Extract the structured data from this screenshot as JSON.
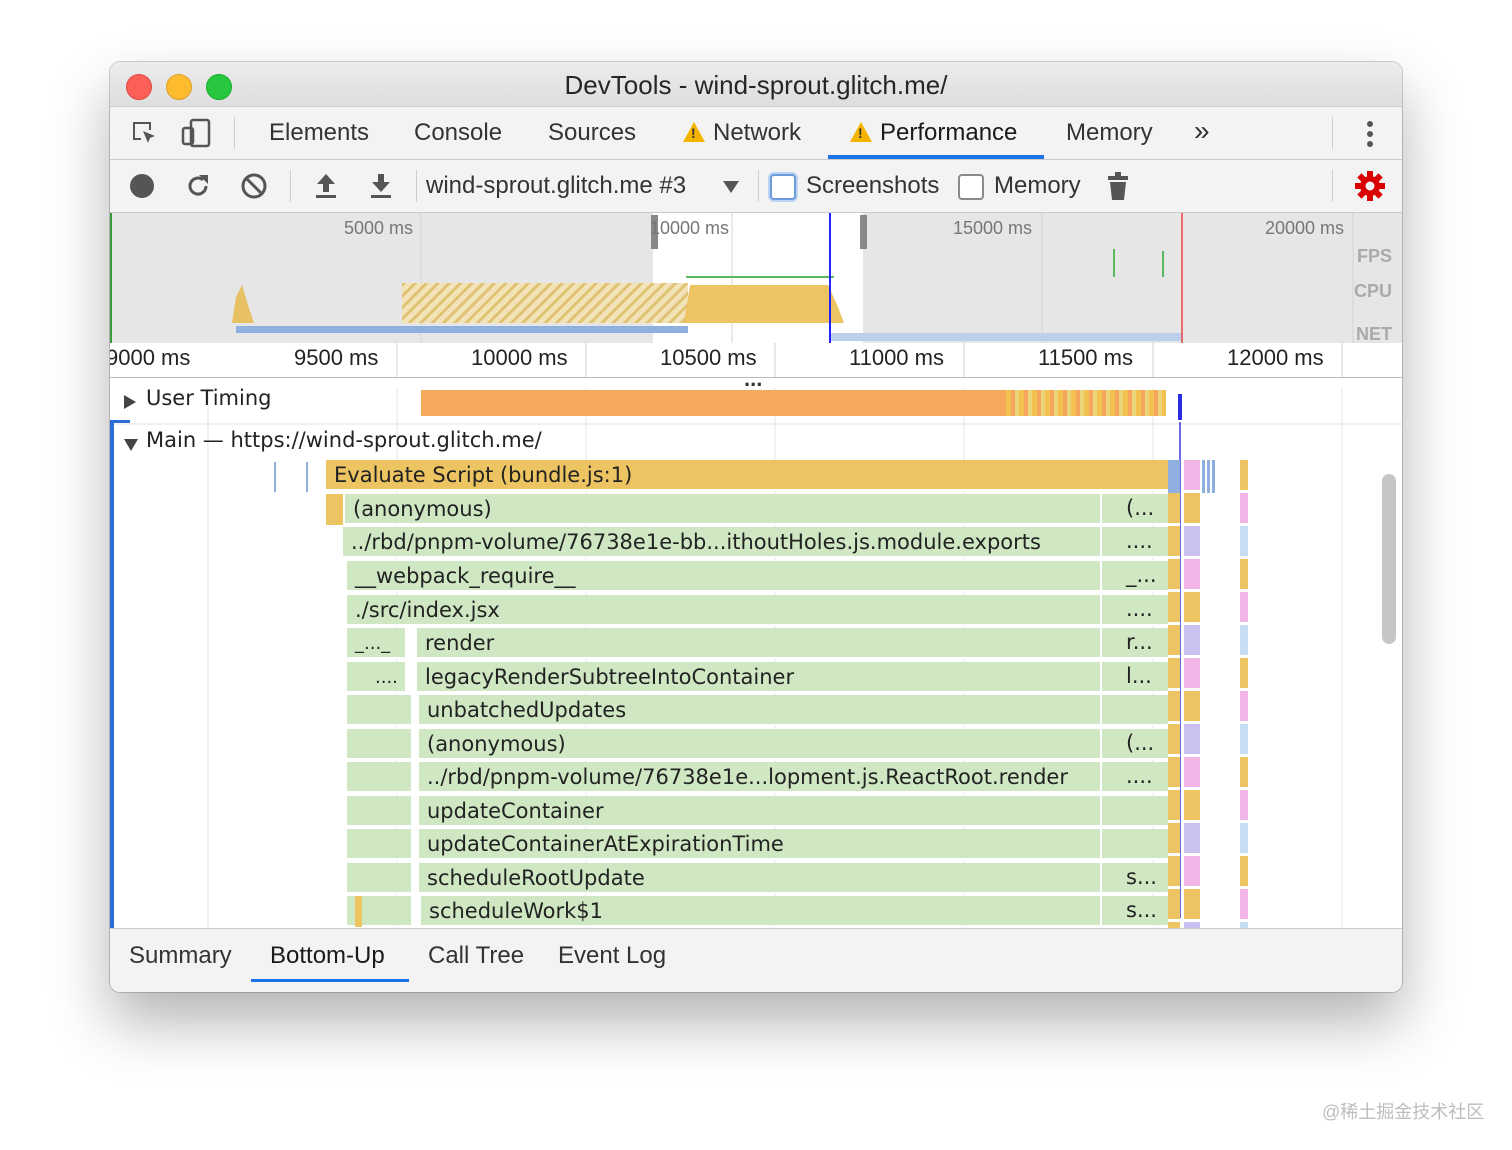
{
  "window": {
    "title": "DevTools - wind-sprout.glitch.me/"
  },
  "tabs": {
    "elements": "Elements",
    "console": "Console",
    "sources": "Sources",
    "network": "Network",
    "performance": "Performance",
    "memory": "Memory",
    "more": "»"
  },
  "toolbar": {
    "profile": "wind-sprout.glitch.me #3",
    "screenshots_label": "Screenshots",
    "memory_label": "Memory",
    "screenshots_checked": false,
    "memory_checked": false
  },
  "overview": {
    "labels": [
      "5000 ms",
      "10000 ms",
      "15000 ms",
      "20000 ms"
    ],
    "side_labels": {
      "fps": "FPS",
      "cpu": "CPU",
      "net": "NET"
    }
  },
  "ruler": {
    "labels": [
      "9000 ms",
      "9500 ms",
      "10000 ms",
      "10500 ms",
      "11000 ms",
      "11500 ms",
      "12000 ms"
    ],
    "collapse": "..."
  },
  "tracks": {
    "user_timing": "User Timing",
    "main": "Main — https://wind-sprout.glitch.me/"
  },
  "flame": {
    "frames": [
      "Evaluate Script (bundle.js:1)",
      "(anonymous)",
      "../rbd/pnpm-volume/76738e1e-bb...ithoutHoles.js.module.exports",
      "__webpack_require__",
      "./src/index.jsx",
      "render",
      "legacyRenderSubtreeIntoContainer",
      "unbatchedUpdates",
      "(anonymous)",
      "../rbd/pnpm-volume/76738e1e...lopment.js.ReactRoot.render",
      "updateContainer",
      "updateContainerAtExpirationTime",
      "scheduleRootUpdate",
      "scheduleWork$1"
    ],
    "tails": [
      "(...",
      "....",
      "_...",
      "....",
      "r...",
      "l...",
      "(...",
      "....",
      "s...",
      "s..."
    ],
    "left_stubs": [
      "_..._",
      "...."
    ]
  },
  "bottom_tabs": {
    "summary": "Summary",
    "bottom_up": "Bottom-Up",
    "call_tree": "Call Tree",
    "event_log": "Event Log"
  },
  "watermark": "@稀土掘金技术社区",
  "colors": {
    "accent": "#1a73e8",
    "scripting": "#ecc461",
    "js_frame": "#cfe8c3",
    "user_timing": "#f7a95b",
    "settings_gear": "#d80000"
  }
}
